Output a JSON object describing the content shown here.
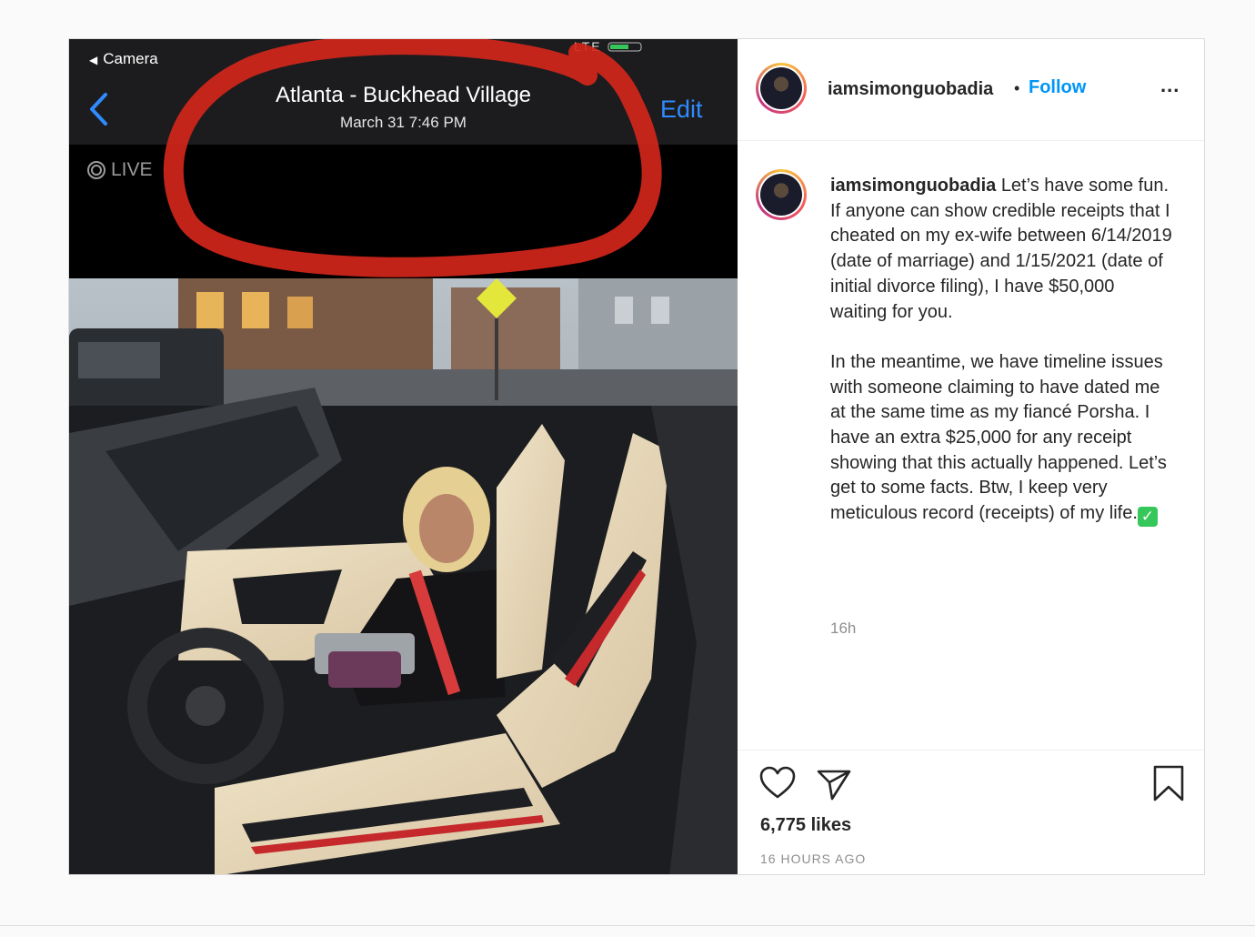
{
  "media": {
    "camera_back_label": "Camera",
    "location_title": "Atlanta - Buckhead Village",
    "location_date": "March 31  7:46 PM",
    "edit_label": "Edit",
    "live_label": "LIVE",
    "status_text": "LTE",
    "annotation_color": "#d3261b"
  },
  "header": {
    "username": "iamsimonguobadia",
    "separator": "•",
    "follow_label": "Follow",
    "more_label": "..."
  },
  "caption": {
    "username": "iamsimonguobadia",
    "paragraph_1": "Let’s have some fun. If anyone can show credible receipts that I cheated on my ex-wife between 6/14/2019 (date of marriage) and 1/15/2021 (date of initial divorce filing), I have $50,000 waiting for you.",
    "paragraph_2": "In the meantime, we have timeline issues with someone claiming to have dated me at the same time as my fiancé Porsha. I have an extra $25,000 for any receipt showing that this actually happened. Let’s get to some facts. Btw, I keep very meticulous record (receipts) of my life.",
    "emoji_check": "✓",
    "time": "16h"
  },
  "footer": {
    "likes": "6,775 likes",
    "time_ago": "16 HOURS AGO",
    "icons": [
      "heart-icon",
      "share-icon",
      "bookmark-icon"
    ]
  },
  "colors": {
    "accent": "#0095f6",
    "edit_blue": "#2f8bff"
  }
}
